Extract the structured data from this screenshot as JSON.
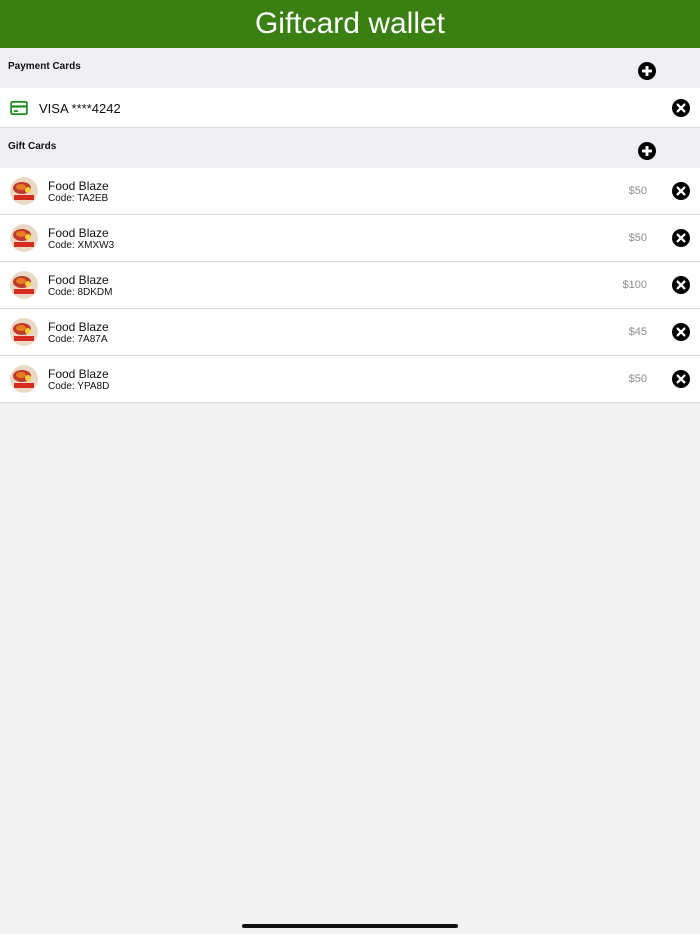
{
  "header": {
    "title": "Giftcard wallet"
  },
  "payment_section": {
    "label": "Payment Cards",
    "add_icon": "plus-circle-icon",
    "cards": [
      {
        "label": "VISA ****4242",
        "icon": "credit-card-icon",
        "icon_color": "#1f8a1f"
      }
    ]
  },
  "gift_section": {
    "label": "Gift Cards",
    "add_icon": "plus-circle-icon",
    "cards": [
      {
        "name": "Food Blaze",
        "code": "Code: TA2EB",
        "amount": "$50"
      },
      {
        "name": "Food Blaze",
        "code": "Code: XMXW3",
        "amount": "$50"
      },
      {
        "name": "Food Blaze",
        "code": "Code: 8DKDM",
        "amount": "$100"
      },
      {
        "name": "Food Blaze",
        "code": "Code: 7A87A",
        "amount": "$45"
      },
      {
        "name": "Food Blaze",
        "code": "Code: YPA8D",
        "amount": "$50"
      }
    ]
  },
  "colors": {
    "header_bg": "#3a7f12",
    "section_bg": "#efeff4",
    "page_bg": "#f2f2f2",
    "amount": "#8e8e8e"
  }
}
